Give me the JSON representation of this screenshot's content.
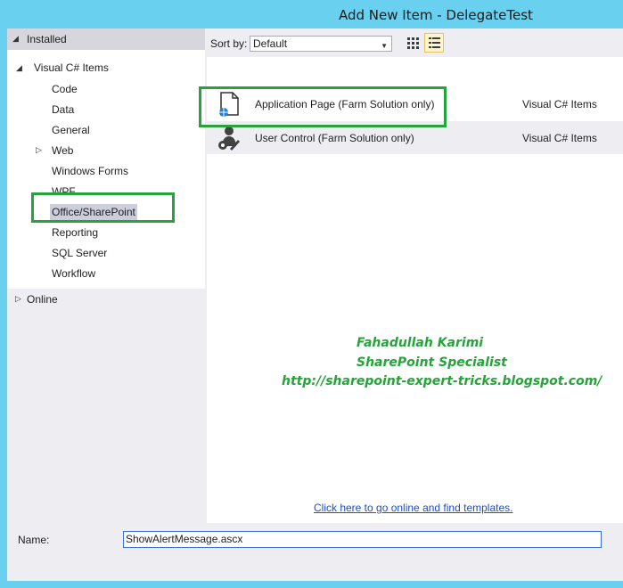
{
  "window": {
    "title": "Add New Item - DelegateTest"
  },
  "left_pane": {
    "installed_label": "Installed",
    "root_label": "Visual C# Items",
    "items": [
      {
        "label": "Code"
      },
      {
        "label": "Data"
      },
      {
        "label": "General"
      },
      {
        "label": "Web"
      },
      {
        "label": "Windows Forms"
      },
      {
        "label": "WPF"
      },
      {
        "label": "Office/SharePoint"
      },
      {
        "label": "Reporting"
      },
      {
        "label": "SQL Server"
      },
      {
        "label": "Workflow"
      }
    ],
    "online_label": "Online"
  },
  "toolbar": {
    "sort_by_label": "Sort by:",
    "sort_value": "Default"
  },
  "templates": [
    {
      "name": "Application Page (Farm Solution only)",
      "language": "Visual C# Items"
    },
    {
      "name": "User Control (Farm Solution only)",
      "language": "Visual C# Items"
    }
  ],
  "watermark": {
    "line1": "Fahadullah Karimi",
    "line2": "SharePoint Specialist",
    "line3": "http://sharepoint-expert-tricks.blogspot.com/"
  },
  "online_link": "Click here to go online and find templates.",
  "bottom": {
    "name_label": "Name:",
    "name_value": "ShowAlertMessage.ascx"
  },
  "colors": {
    "accent_border": "#26a33a",
    "selection": "#cccedb",
    "window_frame": "#6ad0f0"
  }
}
